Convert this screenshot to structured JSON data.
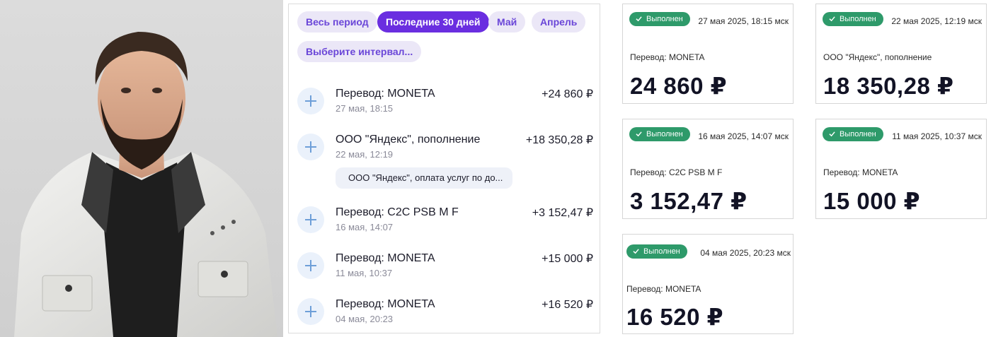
{
  "filters": {
    "chips": [
      {
        "label": "Весь период",
        "active": false
      },
      {
        "label": "Последние 30 дней",
        "active": true
      },
      {
        "label": "Май",
        "active": false
      },
      {
        "label": "Апрель",
        "active": false
      },
      {
        "label": "Выберите интервал...",
        "active": false
      }
    ]
  },
  "transactions": [
    {
      "title": "Перевод: MONETA",
      "date": "27 мая, 18:15",
      "amount": "+24 860 ₽"
    },
    {
      "title": "ООО \"Яндекс\", пополнение",
      "date": "22 мая, 12:19",
      "amount": "+18 350,28 ₽",
      "note": "ООО \"Яндекс\", оплата услуг по до..."
    },
    {
      "title": "Перевод: C2C PSB M F",
      "date": "16 мая, 14:07",
      "amount": "+3 152,47 ₽"
    },
    {
      "title": "Перевод: MONETA",
      "date": "11 мая, 10:37",
      "amount": "+15 000 ₽"
    },
    {
      "title": "Перевод: MONETA",
      "date": "04 мая, 20:23",
      "amount": "+16 520 ₽"
    }
  ],
  "receipts": [
    {
      "status": "Выполнен",
      "datetime": "27 мая 2025, 18:15 мск",
      "description": "Перевод: MONETA",
      "amount": "24 860 ₽"
    },
    {
      "status": "Выполнен",
      "datetime": "22 мая 2025, 12:19 мск",
      "description": "ООО \"Яндекс\", пополнение",
      "amount": "18 350,28 ₽"
    },
    {
      "status": "Выполнен",
      "datetime": "16 мая 2025, 14:07 мск",
      "description": "Перевод: C2C PSB M F",
      "amount": "3 152,47 ₽"
    },
    {
      "status": "Выполнен",
      "datetime": "11 мая 2025, 10:37 мск",
      "description": "Перевод: MONETA",
      "amount": "15 000 ₽"
    },
    {
      "status": "Выполнен",
      "datetime": "04 мая 2025, 20:23 мск",
      "description": "Перевод: MONETA",
      "amount": "16 520 ₽"
    }
  ],
  "colors": {
    "accent": "#6a2ee0",
    "chip_bg": "#ebe7f7",
    "status_green": "#2e9a6a",
    "plus_icon": "#6e9fd8"
  }
}
